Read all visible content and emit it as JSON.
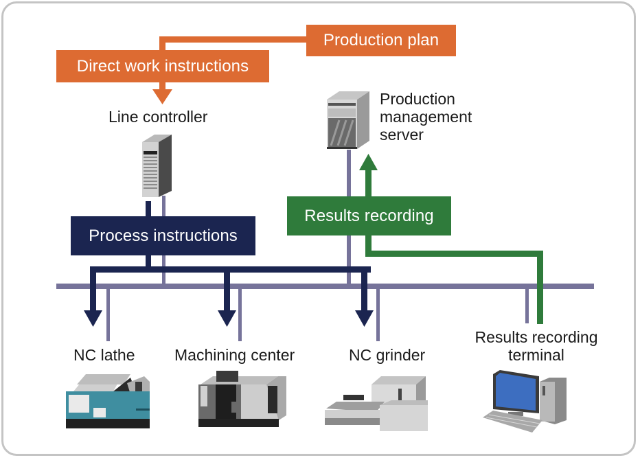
{
  "flows": {
    "production_plan": "Production plan",
    "direct_work_instructions": "Direct work instructions",
    "process_instructions": "Process instructions",
    "results_recording": "Results recording"
  },
  "nodes": {
    "line_controller": "Line controller",
    "production_server": [
      "Production",
      "management",
      "server"
    ],
    "nc_lathe": "NC lathe",
    "machining_center": "Machining center",
    "nc_grinder": "NC grinder",
    "results_terminal": [
      "Results recording",
      "terminal"
    ]
  },
  "colors": {
    "plan_flow": "#dd6b32",
    "process_flow": "#1b2550",
    "results_flow": "#2f7b3b",
    "network_bus": "#76739a",
    "frame_border": "#c4c4c4"
  }
}
